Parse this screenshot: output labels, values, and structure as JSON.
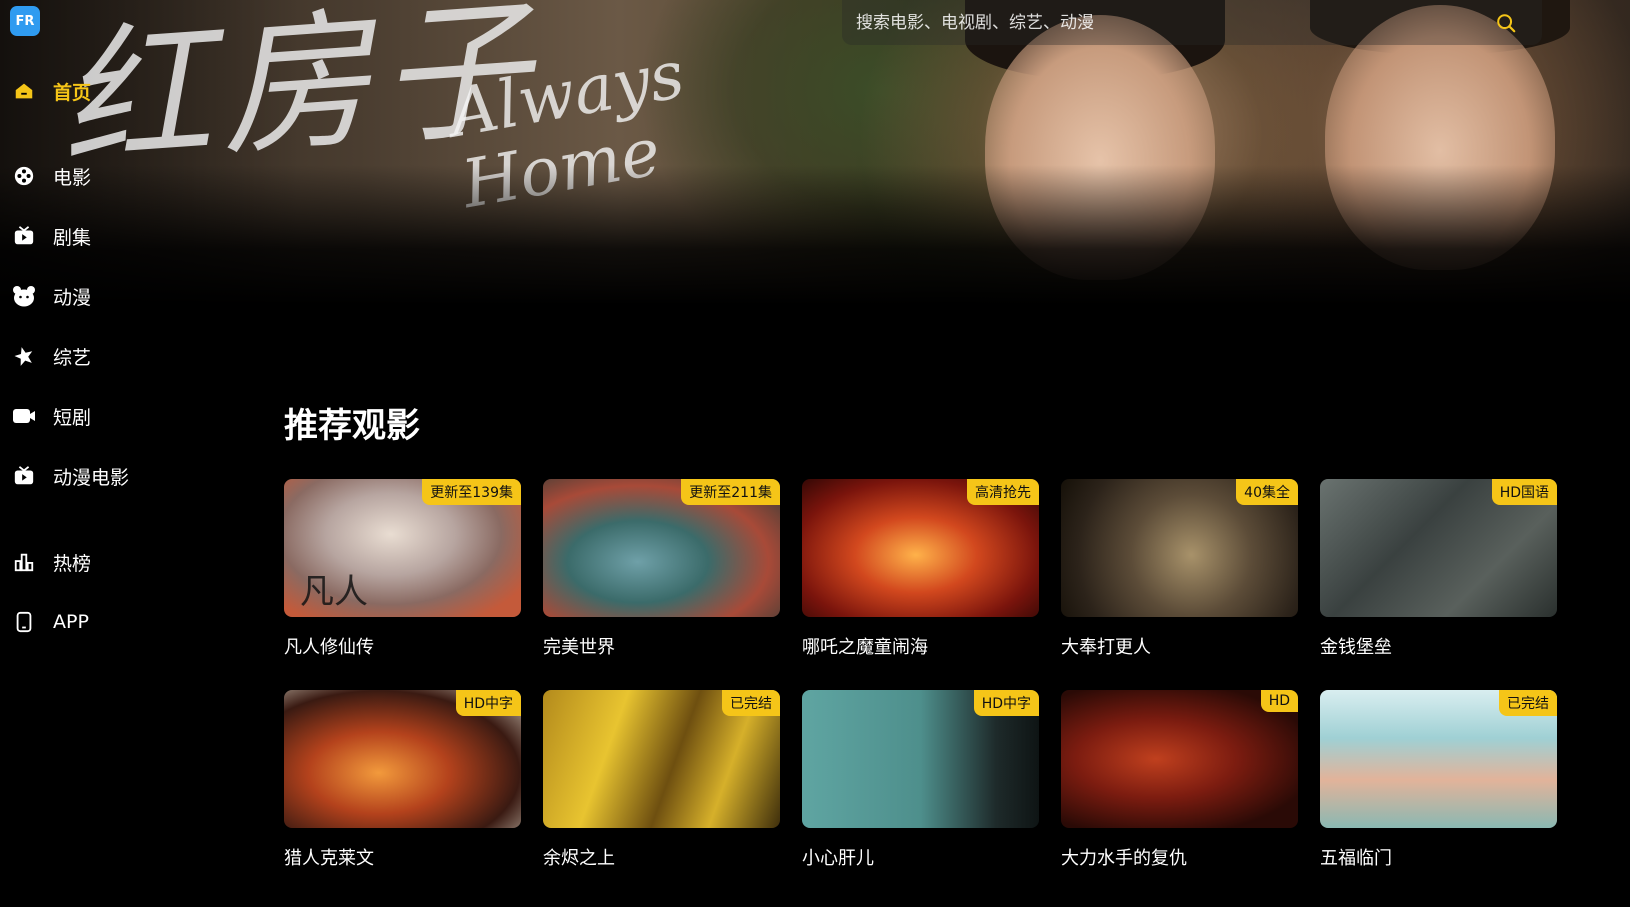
{
  "app": {
    "logo_text": "FR"
  },
  "hero": {
    "title_calligraphy": "红房子",
    "title_script": "Always Home"
  },
  "search": {
    "placeholder": "搜索电影、电视剧、综艺、动漫"
  },
  "sidebar": {
    "items": [
      {
        "label": "首页",
        "icon": "home-icon",
        "active": true
      },
      {
        "label": "电影",
        "icon": "film-reel-icon",
        "active": false
      },
      {
        "label": "剧集",
        "icon": "tv-icon",
        "active": false
      },
      {
        "label": "动漫",
        "icon": "bear-icon",
        "active": false
      },
      {
        "label": "综艺",
        "icon": "star-icon",
        "active": false
      },
      {
        "label": "短剧",
        "icon": "video-camera-icon",
        "active": false
      },
      {
        "label": "动漫电影",
        "icon": "tv-play-icon",
        "active": false
      },
      {
        "label": "热榜",
        "icon": "chart-bar-icon",
        "active": false
      },
      {
        "label": "APP",
        "icon": "phone-icon",
        "active": false
      }
    ]
  },
  "section": {
    "title": "推荐观影"
  },
  "cards": [
    {
      "title": "凡人修仙传",
      "badge": "更新至139集",
      "poster_text": "凡人"
    },
    {
      "title": "完美世界",
      "badge": "更新至211集",
      "poster_text": ""
    },
    {
      "title": "哪吒之魔童闹海",
      "badge": "高清抢先",
      "poster_text": ""
    },
    {
      "title": "大奉打更人",
      "badge": "40集全",
      "poster_text": ""
    },
    {
      "title": "金钱堡垒",
      "badge": "HD国语",
      "poster_text": ""
    },
    {
      "title": "猎人克莱文",
      "badge": "HD中字",
      "poster_text": ""
    },
    {
      "title": "余烬之上",
      "badge": "已完结",
      "poster_text": ""
    },
    {
      "title": "小心肝儿",
      "badge": "HD中字",
      "poster_text": ""
    },
    {
      "title": "大力水手的复仇",
      "badge": "HD",
      "poster_text": ""
    },
    {
      "title": "五福临门",
      "badge": "已完结",
      "poster_text": ""
    }
  ],
  "colors": {
    "accent": "#f5c518",
    "background": "#000000",
    "logo": "#2f9bf0"
  }
}
